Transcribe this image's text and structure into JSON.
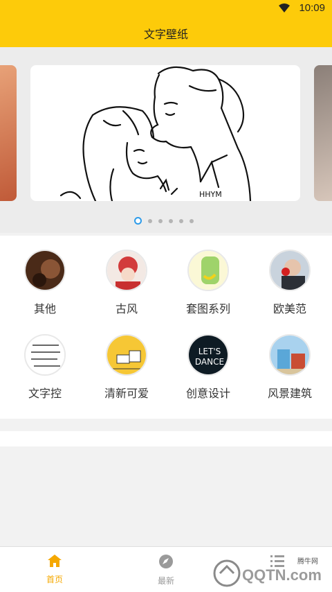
{
  "status": {
    "time": "10:09"
  },
  "header": {
    "title": "文字壁纸"
  },
  "banner": {
    "sketch_caption": "HHYM",
    "dots": 6,
    "active_index": 0
  },
  "categories": [
    {
      "label": "其他"
    },
    {
      "label": "古风"
    },
    {
      "label": "套图系列"
    },
    {
      "label": "欧美范"
    },
    {
      "label": "文字控"
    },
    {
      "label": "清新可爱"
    },
    {
      "label": "创意设计"
    },
    {
      "label": "风景建筑"
    }
  ],
  "category_art": {
    "dance_text_1": "LET'S",
    "dance_text_2": "DANCE"
  },
  "bottom_nav": [
    {
      "label": "首页",
      "icon": "home-icon",
      "active": true
    },
    {
      "label": "最新",
      "icon": "compass-icon",
      "active": false
    },
    {
      "label": "",
      "icon": "list-icon",
      "active": false
    }
  ],
  "watermark": {
    "main": "QQTN.com",
    "badge": "腾牛网"
  },
  "colors": {
    "accent": "#fdcb0a",
    "nav_active": "#f5a800",
    "nav_inactive": "#9a9a9a",
    "dot_active": "#2d9be9"
  }
}
